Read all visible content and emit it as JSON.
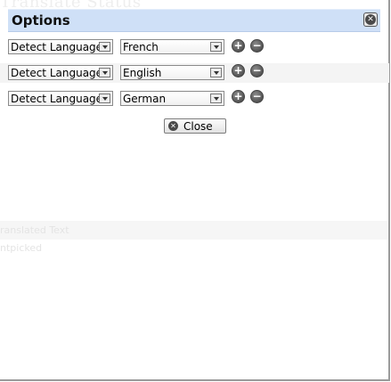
{
  "background": {
    "heading": "Translate Status",
    "band_text_1": "ranslated Text",
    "band_text_2": "ntpicked"
  },
  "dialog": {
    "title": "Options",
    "title_close_glyph": "✕",
    "rows": [
      {
        "source": "Detect Language",
        "target": "French"
      },
      {
        "source": "Detect Language",
        "target": "English"
      },
      {
        "source": "Detect Language",
        "target": "German"
      }
    ],
    "add_glyph": "+",
    "remove_glyph": "−",
    "close_button_label": "Close",
    "close_button_glyph": "✕"
  },
  "colors": {
    "titlebar": "#cfe0f7",
    "row_shade": "#f4f4f4"
  }
}
